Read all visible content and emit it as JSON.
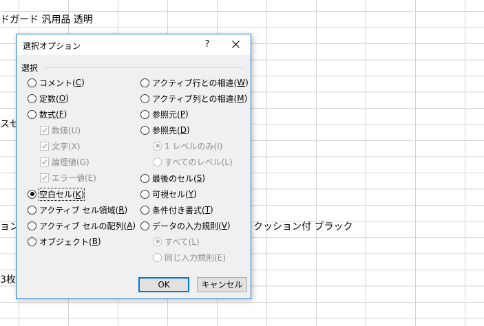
{
  "sheet": {
    "cells": [
      {
        "text": "ドガード 汎用品 透明"
      },
      {
        "text": "スセ"
      },
      {
        "text": "ョン"
      },
      {
        "text": "クッション付 ブラック"
      },
      {
        "text": "3枚"
      }
    ]
  },
  "dialog": {
    "title": "選択オプション",
    "help": "?",
    "group_label": "選択",
    "left_options": [
      {
        "label": "コメント(",
        "key": "C",
        "end": ")"
      },
      {
        "label": "定数(",
        "key": "O",
        "end": ")"
      },
      {
        "label": "数式(",
        "key": "F",
        "end": ")"
      },
      {
        "label": "数値(U)"
      },
      {
        "label": "文字(X)"
      },
      {
        "label": "論理値(G)"
      },
      {
        "label": "エラー値(E)"
      },
      {
        "label": "空白セル(",
        "key": "K",
        "end": ")"
      },
      {
        "label": "アクティブ セル領域(",
        "key": "R",
        "end": ")"
      },
      {
        "label": "アクティブ セルの配列(",
        "key": "A",
        "end": ")"
      },
      {
        "label": "オブジェクト(",
        "key": "B",
        "end": ")"
      }
    ],
    "right_options": [
      {
        "label": "アクティブ行との相違(",
        "key": "W",
        "end": ")"
      },
      {
        "label": "アクティブ列との相違(",
        "key": "M",
        "end": ")"
      },
      {
        "label": "参照元(",
        "key": "P",
        "end": ")"
      },
      {
        "label": "参照先(",
        "key": "D",
        "end": ")"
      },
      {
        "label": "1 レベルのみ(I)"
      },
      {
        "label": "すべてのレベル(L)"
      },
      {
        "label": "最後のセル(",
        "key": "S",
        "end": ")"
      },
      {
        "label": "可視セル(",
        "key": "Y",
        "end": ")"
      },
      {
        "label": "条件付き書式(",
        "key": "T",
        "end": ")"
      },
      {
        "label": "データの入力規則(",
        "key": "V",
        "end": ")"
      },
      {
        "label": "すべて(L)"
      },
      {
        "label": "同じ入力規則(E)"
      }
    ],
    "selected": "空白セル(K)",
    "ok_label": "OK",
    "cancel_label": "キャンセル"
  },
  "colors": {
    "dialog_border": "#1979ca",
    "default_button_border": "#0078d7",
    "disabled_text": "#8d8d8d"
  }
}
